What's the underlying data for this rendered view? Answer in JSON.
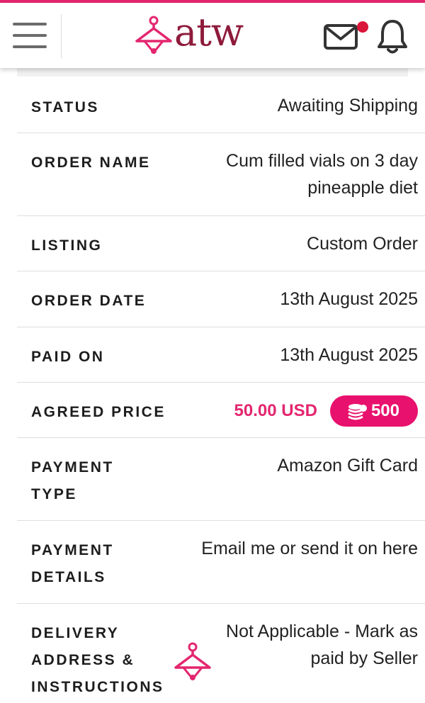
{
  "header": {
    "brand": "atw",
    "brand_color": "#8e1b3b",
    "accent_color": "#e3266f",
    "icons": [
      "menu-icon",
      "hanger-logo-icon",
      "mail-icon",
      "notification-dot",
      "bell-icon"
    ]
  },
  "order": {
    "status_label": "STATUS",
    "status_value": "Awaiting Shipping",
    "name_label": "ORDER NAME",
    "name_value": "Cum filled vials on 3 day pineapple diet",
    "listing_label": "LISTING",
    "listing_value": "Custom Order",
    "date_label": "ORDER DATE",
    "date_value": "13th August 2025",
    "paid_label": "PAID ON",
    "paid_value": "13th August 2025",
    "price_label": "AGREED PRICE",
    "price_value": "50.00 USD",
    "coins_value": "500",
    "payment_type_label": "PAYMENT TYPE",
    "payment_type_value": "Amazon Gift Card",
    "payment_details_label": "PAYMENT DETAILS",
    "payment_details_value": "Email me or send it on here",
    "delivery_label": "DELIVERY ADDRESS & INSTRUCTIONS",
    "delivery_value": "Not Applicable - Mark as paid by Seller"
  }
}
